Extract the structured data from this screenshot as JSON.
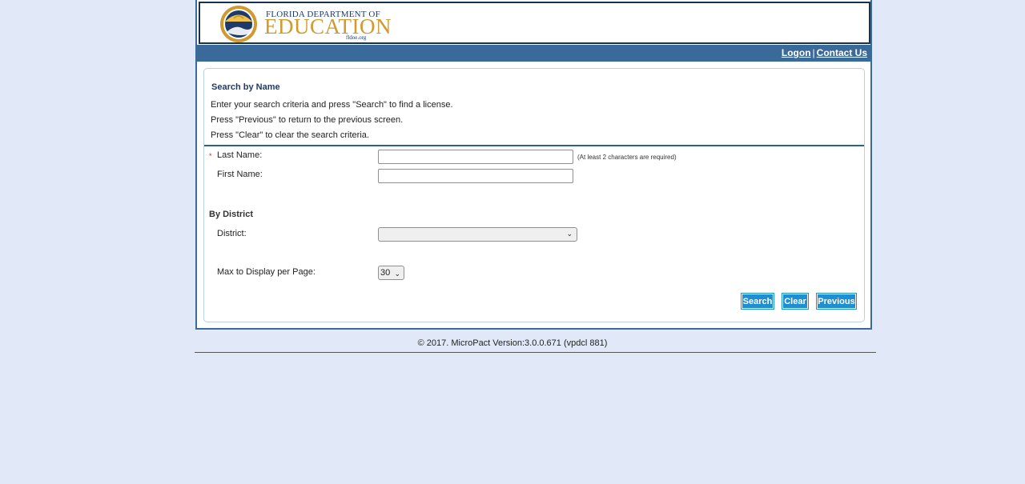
{
  "header": {
    "logo_top": "FLORIDA DEPARTMENT OF",
    "logo_main": "EDUCATION",
    "logo_url": "fldoe.org"
  },
  "nav": {
    "logon": "Logon",
    "separator": "|",
    "contact": "Contact Us"
  },
  "panel": {
    "title": "Search by Name",
    "instructions": [
      "Enter your search criteria and press \"Search\" to find a license.",
      "Press \"Previous\" to return to the previous screen.",
      "Press \"Clear\" to clear the search criteria."
    ]
  },
  "form": {
    "required_mark": "*",
    "last_name_label": "Last Name:",
    "last_name_value": "",
    "last_name_hint": "(At least 2 characters are required)",
    "first_name_label": "First Name:",
    "first_name_value": "",
    "section_district": "By District",
    "district_label": "District:",
    "district_value": "",
    "max_label": "Max to Display per Page:",
    "max_value": "30"
  },
  "buttons": {
    "search": "Search",
    "clear": "Clear",
    "previous": "Previous"
  },
  "footer": {
    "text": "© 2017. MicroPact Version:3.0.0.671 (vpdcl 881)"
  },
  "colors": {
    "page_bg": "#e1e9f8",
    "nav_bg": "#3a6a99",
    "button_bg": "#1e8fd0",
    "gold": "#cf9a2f"
  }
}
